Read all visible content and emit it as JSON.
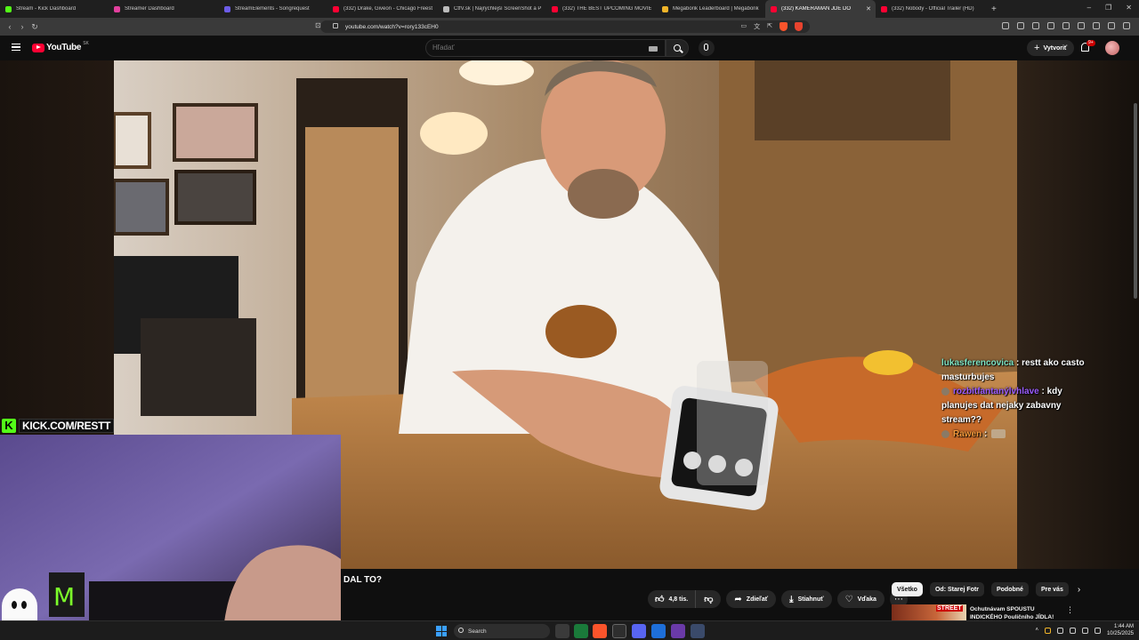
{
  "browser": {
    "tabs": [
      {
        "label": "Stream - Kick Dashboard",
        "color": "#53fc18"
      },
      {
        "label": "Streamer Dashboard",
        "color": "#e23f9d"
      },
      {
        "label": "StreamElements - Songrequest",
        "color": "#6c5ce7"
      },
      {
        "label": "(332) Drake, Giveon - Chicago Freesty",
        "color": "#ff0033"
      },
      {
        "label": "ČtfV.sk | Najrýchlejší ScreenShot a P",
        "color": "#bbbbbb"
      },
      {
        "label": "(332) THE BEST UPCOMING MOVIES",
        "color": "#ff0033"
      },
      {
        "label": "Megaborik Leaderboard | Megaborik",
        "color": "#f0b429"
      },
      {
        "label": "(332) KAMERAMAN JDE DO",
        "color": "#ff0033",
        "active": true
      },
      {
        "label": "(332) Nobody - Official Trailer (HD)",
        "color": "#ff0033"
      }
    ],
    "new_tab": "+",
    "url": "youtube.com/watch?v=rory133cEH0"
  },
  "youtube": {
    "logo_text": "YouTube",
    "region": "SK",
    "search_placeholder": "Hľadať",
    "create_label": "Vytvoriť",
    "notif_count": "9+"
  },
  "overlay": {
    "kick_letter": "K",
    "kick_url": "KICK.COM/RESTT"
  },
  "chat": [
    {
      "user": "lukasferencovica",
      "sep": " : ",
      "text": "restt ako casto masturbujes",
      "color": "green"
    },
    {
      "user": "rozbitfantanýlvhlave",
      "sep": " : ",
      "text": "kdy planujes dat nejaky zabavny stream??",
      "color": "purple"
    },
    {
      "user": "Rawen",
      "sep": " : ",
      "text": "",
      "color": "orange"
    }
  ],
  "video": {
    "title": "DAL TO?",
    "likes": "4,8 tis.",
    "share_label": "Zdieľať",
    "download_label": "Stiahnuť",
    "thanks_label": "Vďaka"
  },
  "chips": [
    "Všetko",
    "Od: Starej Fotr",
    "Podobné",
    "Pre vás"
  ],
  "recommendation": {
    "thumb_text": "STREET",
    "title": "Ochutnávam SPOUSTU INDICKÉHO Pouličního JÍDLA!"
  },
  "taskbar": {
    "search_label": "Search",
    "time": "1:44 AM",
    "date": "10/25/2025"
  }
}
